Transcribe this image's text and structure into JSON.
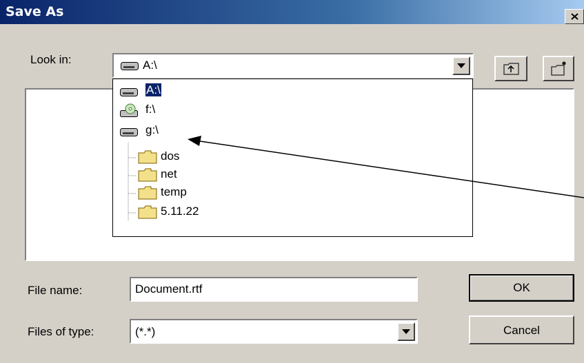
{
  "window": {
    "title": "Save As"
  },
  "look_in": {
    "label": "Look in:",
    "value": "A:\\",
    "options": [
      {
        "label": "A:\\",
        "icon": "floppy-drive-icon",
        "selected": true
      },
      {
        "label": "f:\\",
        "icon": "cd-drive-icon"
      },
      {
        "label": "g:\\",
        "icon": "hard-drive-icon"
      },
      {
        "label": "dos",
        "icon": "folder-icon"
      },
      {
        "label": "net",
        "icon": "folder-icon"
      },
      {
        "label": "temp",
        "icon": "folder-icon"
      },
      {
        "label": "5.11.22",
        "icon": "folder-icon"
      }
    ]
  },
  "toolbar": {
    "up_icon": "up-one-level-icon",
    "new_folder_icon": "new-folder-icon"
  },
  "file_name": {
    "label": "File name:",
    "value": "Document.rtf"
  },
  "file_type": {
    "label": "Files of type:",
    "value": "(*.*)"
  },
  "buttons": {
    "ok": "OK",
    "cancel": "Cancel"
  }
}
